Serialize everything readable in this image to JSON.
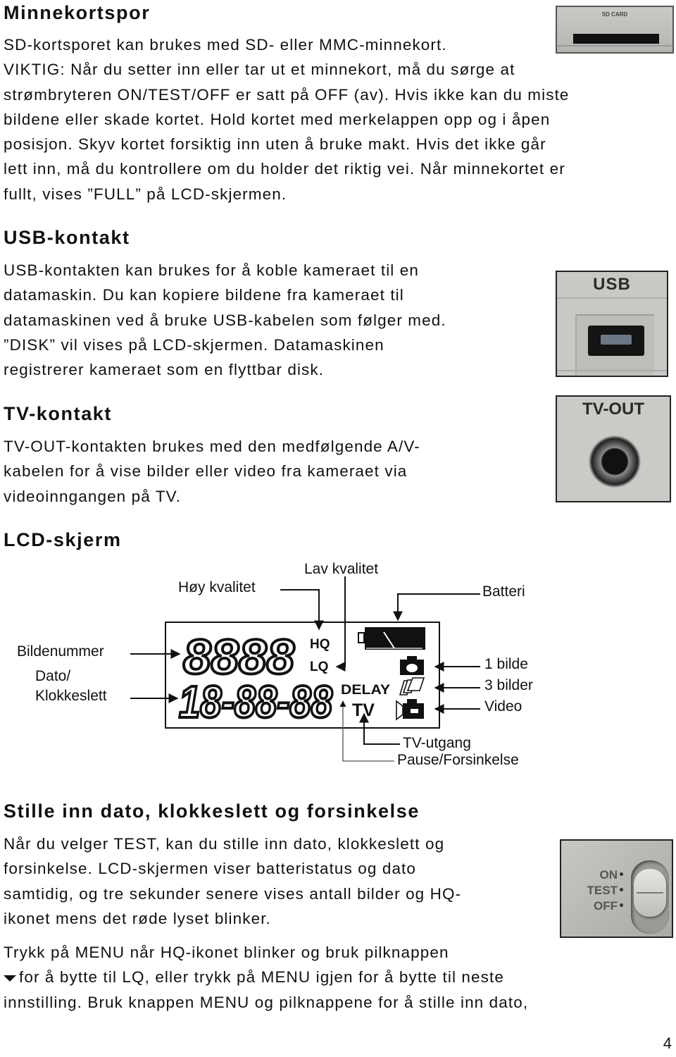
{
  "page_number": "4",
  "sections": {
    "memory": {
      "heading": "Minnekortspor",
      "lines": [
        "SD-kortsporet kan brukes med SD- eller MMC-minnekort.",
        "VIKTIG: Når du setter inn eller tar ut et minnekort, må du sørge at",
        "strømbryteren ON/TEST/OFF er satt på OFF (av). Hvis ikke kan du miste",
        "bildene eller skade kortet. Hold kortet med merkelappen opp og i åpen",
        "posisjon. Skyv kortet forsiktig inn uten å bruke makt. Hvis det ikke går",
        "lett inn, må du kontrollere om du holder det riktig vei. Når minnekortet er",
        "fullt, vises ”FULL” på LCD-skjermen."
      ],
      "photo_label": "SD CARD"
    },
    "usb": {
      "heading": "USB-kontakt",
      "lines": [
        "USB-kontakten kan brukes for å koble kameraet til en",
        "datamaskin. Du kan kopiere bildene fra kameraet til",
        "datamaskinen ved å bruke USB-kabelen som følger med.",
        "”DISK” vil vises på LCD-skjermen. Datamaskinen",
        "registrerer kameraet som en flyttbar disk."
      ],
      "photo_label": "USB"
    },
    "tv": {
      "heading": "TV-kontakt",
      "lines": [
        "TV-OUT-kontakten brukes med den medfølgende A/V-",
        "kabelen for å vise bilder eller video fra kameraet via",
        "videoinngangen på TV."
      ],
      "photo_label": "TV-OUT"
    },
    "lcd": {
      "heading": "LCD-skjerm",
      "display": {
        "image_number": "8888",
        "date_time": "18-88-88",
        "hq": "HQ",
        "lq": "LQ",
        "delay": "DELAY",
        "tv": "TV"
      },
      "callouts": {
        "high_quality": "Høy kvalitet",
        "low_quality": "Lav kvalitet",
        "battery": "Batteri",
        "image_number": "Bildenummer",
        "date_line1": "Dato/",
        "date_line2": "Klokkeslett",
        "one_image": "1 bilde",
        "three_images": "3 bilder",
        "video": "Video",
        "tv_out": "TV-utgang",
        "pause_delay": "Pause/Forsinkelse"
      }
    },
    "settings": {
      "heading": "Stille inn dato, klokkeslett og forsinkelse",
      "lines": [
        "Når du velger TEST, kan du stille inn dato, klokkeslett og",
        "forsinkelse. LCD-skjermen viser batteristatus og dato",
        "samtidig, og tre sekunder senere vises antall bilder og HQ-",
        "ikonet mens det røde lyset blinker."
      ],
      "lines2": [
        "Trykk på MENU når HQ-ikonet blinker og bruk pilknappen",
        "for å bytte til LQ, eller trykk på MENU igjen for å bytte til neste",
        "innstilling. Bruk knappen MENU og pilknappene for å stille inn dato,"
      ],
      "switch_labels": [
        "ON",
        "TEST",
        "OFF"
      ]
    }
  }
}
